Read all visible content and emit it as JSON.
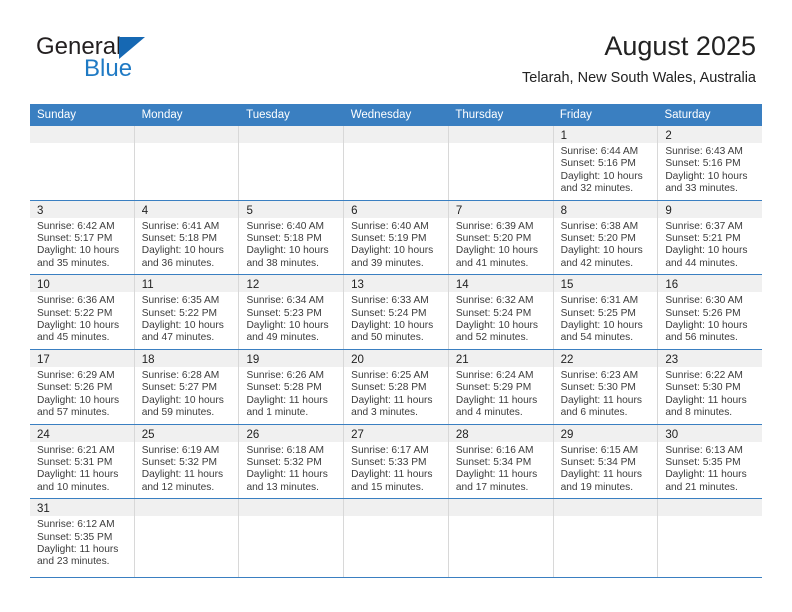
{
  "brand": {
    "name_top": "General",
    "name_bottom": "Blue",
    "accent_color": "#1668b3"
  },
  "header": {
    "title": "August 2025",
    "subtitle": "Telarah, New South Wales, Australia"
  },
  "theme": {
    "header_blue": "#3a7fc1",
    "date_band_gray": "#f0f0f0",
    "grid_line": "#d8d8d8"
  },
  "weekdays": [
    "Sunday",
    "Monday",
    "Tuesday",
    "Wednesday",
    "Thursday",
    "Friday",
    "Saturday"
  ],
  "weeks": [
    [
      {
        "day": "",
        "lines": []
      },
      {
        "day": "",
        "lines": []
      },
      {
        "day": "",
        "lines": []
      },
      {
        "day": "",
        "lines": []
      },
      {
        "day": "",
        "lines": []
      },
      {
        "day": "1",
        "lines": [
          "Sunrise: 6:44 AM",
          "Sunset: 5:16 PM",
          "Daylight: 10 hours",
          "and 32 minutes."
        ]
      },
      {
        "day": "2",
        "lines": [
          "Sunrise: 6:43 AM",
          "Sunset: 5:16 PM",
          "Daylight: 10 hours",
          "and 33 minutes."
        ]
      }
    ],
    [
      {
        "day": "3",
        "lines": [
          "Sunrise: 6:42 AM",
          "Sunset: 5:17 PM",
          "Daylight: 10 hours",
          "and 35 minutes."
        ]
      },
      {
        "day": "4",
        "lines": [
          "Sunrise: 6:41 AM",
          "Sunset: 5:18 PM",
          "Daylight: 10 hours",
          "and 36 minutes."
        ]
      },
      {
        "day": "5",
        "lines": [
          "Sunrise: 6:40 AM",
          "Sunset: 5:18 PM",
          "Daylight: 10 hours",
          "and 38 minutes."
        ]
      },
      {
        "day": "6",
        "lines": [
          "Sunrise: 6:40 AM",
          "Sunset: 5:19 PM",
          "Daylight: 10 hours",
          "and 39 minutes."
        ]
      },
      {
        "day": "7",
        "lines": [
          "Sunrise: 6:39 AM",
          "Sunset: 5:20 PM",
          "Daylight: 10 hours",
          "and 41 minutes."
        ]
      },
      {
        "day": "8",
        "lines": [
          "Sunrise: 6:38 AM",
          "Sunset: 5:20 PM",
          "Daylight: 10 hours",
          "and 42 minutes."
        ]
      },
      {
        "day": "9",
        "lines": [
          "Sunrise: 6:37 AM",
          "Sunset: 5:21 PM",
          "Daylight: 10 hours",
          "and 44 minutes."
        ]
      }
    ],
    [
      {
        "day": "10",
        "lines": [
          "Sunrise: 6:36 AM",
          "Sunset: 5:22 PM",
          "Daylight: 10 hours",
          "and 45 minutes."
        ]
      },
      {
        "day": "11",
        "lines": [
          "Sunrise: 6:35 AM",
          "Sunset: 5:22 PM",
          "Daylight: 10 hours",
          "and 47 minutes."
        ]
      },
      {
        "day": "12",
        "lines": [
          "Sunrise: 6:34 AM",
          "Sunset: 5:23 PM",
          "Daylight: 10 hours",
          "and 49 minutes."
        ]
      },
      {
        "day": "13",
        "lines": [
          "Sunrise: 6:33 AM",
          "Sunset: 5:24 PM",
          "Daylight: 10 hours",
          "and 50 minutes."
        ]
      },
      {
        "day": "14",
        "lines": [
          "Sunrise: 6:32 AM",
          "Sunset: 5:24 PM",
          "Daylight: 10 hours",
          "and 52 minutes."
        ]
      },
      {
        "day": "15",
        "lines": [
          "Sunrise: 6:31 AM",
          "Sunset: 5:25 PM",
          "Daylight: 10 hours",
          "and 54 minutes."
        ]
      },
      {
        "day": "16",
        "lines": [
          "Sunrise: 6:30 AM",
          "Sunset: 5:26 PM",
          "Daylight: 10 hours",
          "and 56 minutes."
        ]
      }
    ],
    [
      {
        "day": "17",
        "lines": [
          "Sunrise: 6:29 AM",
          "Sunset: 5:26 PM",
          "Daylight: 10 hours",
          "and 57 minutes."
        ]
      },
      {
        "day": "18",
        "lines": [
          "Sunrise: 6:28 AM",
          "Sunset: 5:27 PM",
          "Daylight: 10 hours",
          "and 59 minutes."
        ]
      },
      {
        "day": "19",
        "lines": [
          "Sunrise: 6:26 AM",
          "Sunset: 5:28 PM",
          "Daylight: 11 hours",
          "and 1 minute."
        ]
      },
      {
        "day": "20",
        "lines": [
          "Sunrise: 6:25 AM",
          "Sunset: 5:28 PM",
          "Daylight: 11 hours",
          "and 3 minutes."
        ]
      },
      {
        "day": "21",
        "lines": [
          "Sunrise: 6:24 AM",
          "Sunset: 5:29 PM",
          "Daylight: 11 hours",
          "and 4 minutes."
        ]
      },
      {
        "day": "22",
        "lines": [
          "Sunrise: 6:23 AM",
          "Sunset: 5:30 PM",
          "Daylight: 11 hours",
          "and 6 minutes."
        ]
      },
      {
        "day": "23",
        "lines": [
          "Sunrise: 6:22 AM",
          "Sunset: 5:30 PM",
          "Daylight: 11 hours",
          "and 8 minutes."
        ]
      }
    ],
    [
      {
        "day": "24",
        "lines": [
          "Sunrise: 6:21 AM",
          "Sunset: 5:31 PM",
          "Daylight: 11 hours",
          "and 10 minutes."
        ]
      },
      {
        "day": "25",
        "lines": [
          "Sunrise: 6:19 AM",
          "Sunset: 5:32 PM",
          "Daylight: 11 hours",
          "and 12 minutes."
        ]
      },
      {
        "day": "26",
        "lines": [
          "Sunrise: 6:18 AM",
          "Sunset: 5:32 PM",
          "Daylight: 11 hours",
          "and 13 minutes."
        ]
      },
      {
        "day": "27",
        "lines": [
          "Sunrise: 6:17 AM",
          "Sunset: 5:33 PM",
          "Daylight: 11 hours",
          "and 15 minutes."
        ]
      },
      {
        "day": "28",
        "lines": [
          "Sunrise: 6:16 AM",
          "Sunset: 5:34 PM",
          "Daylight: 11 hours",
          "and 17 minutes."
        ]
      },
      {
        "day": "29",
        "lines": [
          "Sunrise: 6:15 AM",
          "Sunset: 5:34 PM",
          "Daylight: 11 hours",
          "and 19 minutes."
        ]
      },
      {
        "day": "30",
        "lines": [
          "Sunrise: 6:13 AM",
          "Sunset: 5:35 PM",
          "Daylight: 11 hours",
          "and 21 minutes."
        ]
      }
    ],
    [
      {
        "day": "31",
        "lines": [
          "Sunrise: 6:12 AM",
          "Sunset: 5:35 PM",
          "Daylight: 11 hours",
          "and 23 minutes."
        ]
      },
      {
        "day": "",
        "lines": []
      },
      {
        "day": "",
        "lines": []
      },
      {
        "day": "",
        "lines": []
      },
      {
        "day": "",
        "lines": []
      },
      {
        "day": "",
        "lines": []
      },
      {
        "day": "",
        "lines": []
      }
    ]
  ]
}
